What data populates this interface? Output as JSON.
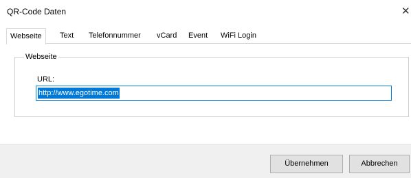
{
  "window": {
    "title": "QR-Code Daten",
    "close_glyph": "✕"
  },
  "tabs": [
    {
      "label": "Webseite",
      "active": true
    },
    {
      "label": "Text",
      "active": false
    },
    {
      "label": "Telefonnummer",
      "active": false
    },
    {
      "label": "vCard",
      "active": false
    },
    {
      "label": "Event",
      "active": false
    },
    {
      "label": "WiFi Login",
      "active": false
    }
  ],
  "webseite": {
    "group_title": "Webseite",
    "url_label": "URL:",
    "url_value": "http://www.egotime.com"
  },
  "buttons": {
    "apply": "Übernehmen",
    "cancel": "Abbrechen"
  },
  "colors": {
    "accent": "#0078d7",
    "button_bar": "#f0f0f0",
    "button_face": "#e1e1e1"
  },
  "icons": {
    "close": "close-icon"
  }
}
